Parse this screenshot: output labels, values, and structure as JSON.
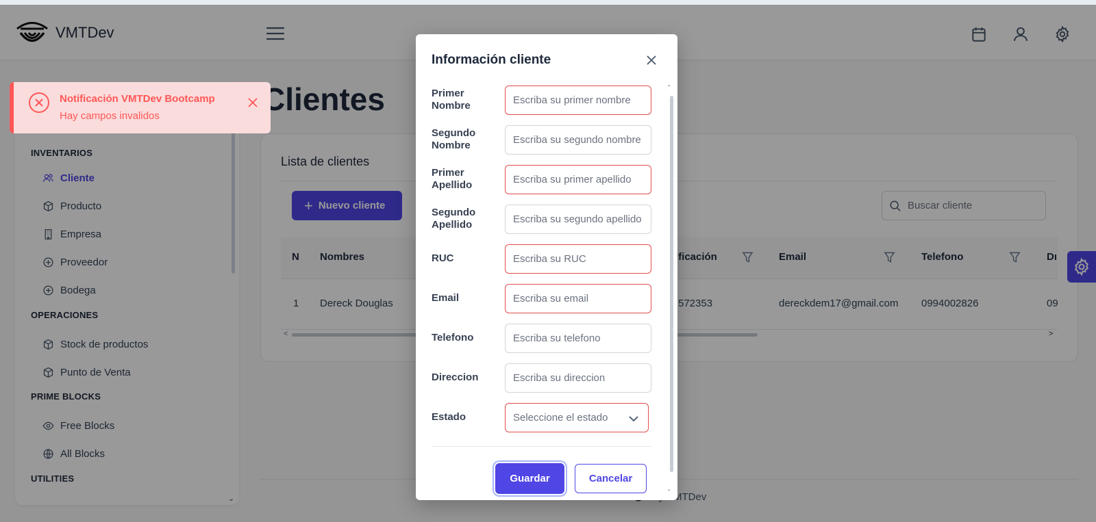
{
  "app": {
    "name": "VMTDev"
  },
  "sidebar": {
    "sections": [
      {
        "title": "INVENTARIOS",
        "items": [
          {
            "label": "Cliente",
            "icon": "users-icon",
            "active": true
          },
          {
            "label": "Producto",
            "icon": "box-icon"
          },
          {
            "label": "Empresa",
            "icon": "building-icon"
          },
          {
            "label": "Proveedor",
            "icon": "plus-circle-icon"
          },
          {
            "label": "Bodega",
            "icon": "plus-circle-icon"
          }
        ]
      },
      {
        "title": "OPERACIONES",
        "items": [
          {
            "label": "Stock de productos",
            "icon": "box-icon"
          },
          {
            "label": "Punto de Venta",
            "icon": "box-icon"
          }
        ]
      },
      {
        "title": "PRIME BLOCKS",
        "items": [
          {
            "label": "Free Blocks",
            "icon": "eye-icon"
          },
          {
            "label": "All Blocks",
            "icon": "globe-icon"
          }
        ]
      },
      {
        "title": "UTILITIES",
        "items": []
      }
    ]
  },
  "main": {
    "page_title": "Clientes",
    "card_title": "Lista de clientes",
    "new_button": "Nuevo cliente",
    "search_placeholder": "Buscar cliente",
    "columns": [
      "N",
      "Nombres",
      "ificación",
      "Email",
      "Telefono",
      "Dı"
    ],
    "rows": [
      {
        "n": "1",
        "nombres": "Dereck Douglas",
        "identificacion": "572353",
        "email": "dereckdem17@gmail.com",
        "telefono": "0994002826",
        "extra": "09"
      }
    ],
    "footer_text": "by VMTDev"
  },
  "toast": {
    "title": "Notificación VMTDev Bootcamp",
    "message": "Hay campos invalidos"
  },
  "dialog": {
    "title": "Información cliente",
    "fields": [
      {
        "label": "Primer Nombre",
        "placeholder": "Escriba su primer nombre",
        "invalid": true
      },
      {
        "label": "Segundo Nombre",
        "placeholder": "Escriba su segundo nombre",
        "invalid": false
      },
      {
        "label": "Primer Apellido",
        "placeholder": "Escriba su primer apellido",
        "invalid": true
      },
      {
        "label": "Segundo Apellido",
        "placeholder": "Escriba su segundo apellido",
        "invalid": false
      },
      {
        "label": "RUC",
        "placeholder": "Escriba su RUC",
        "invalid": true
      },
      {
        "label": "Email",
        "placeholder": "Escriba su email",
        "invalid": true
      },
      {
        "label": "Telefono",
        "placeholder": "Escriba su telefono",
        "invalid": false
      },
      {
        "label": "Direccion",
        "placeholder": "Escriba su direccion",
        "invalid": false
      }
    ],
    "estado": {
      "label": "Estado",
      "placeholder": "Seleccione el estado",
      "invalid": true
    },
    "save_label": "Guardar",
    "cancel_label": "Cancelar"
  },
  "colors": {
    "accent": "#4f46e5",
    "error": "#ff5757",
    "toast_bg": "#fbdcdc"
  }
}
